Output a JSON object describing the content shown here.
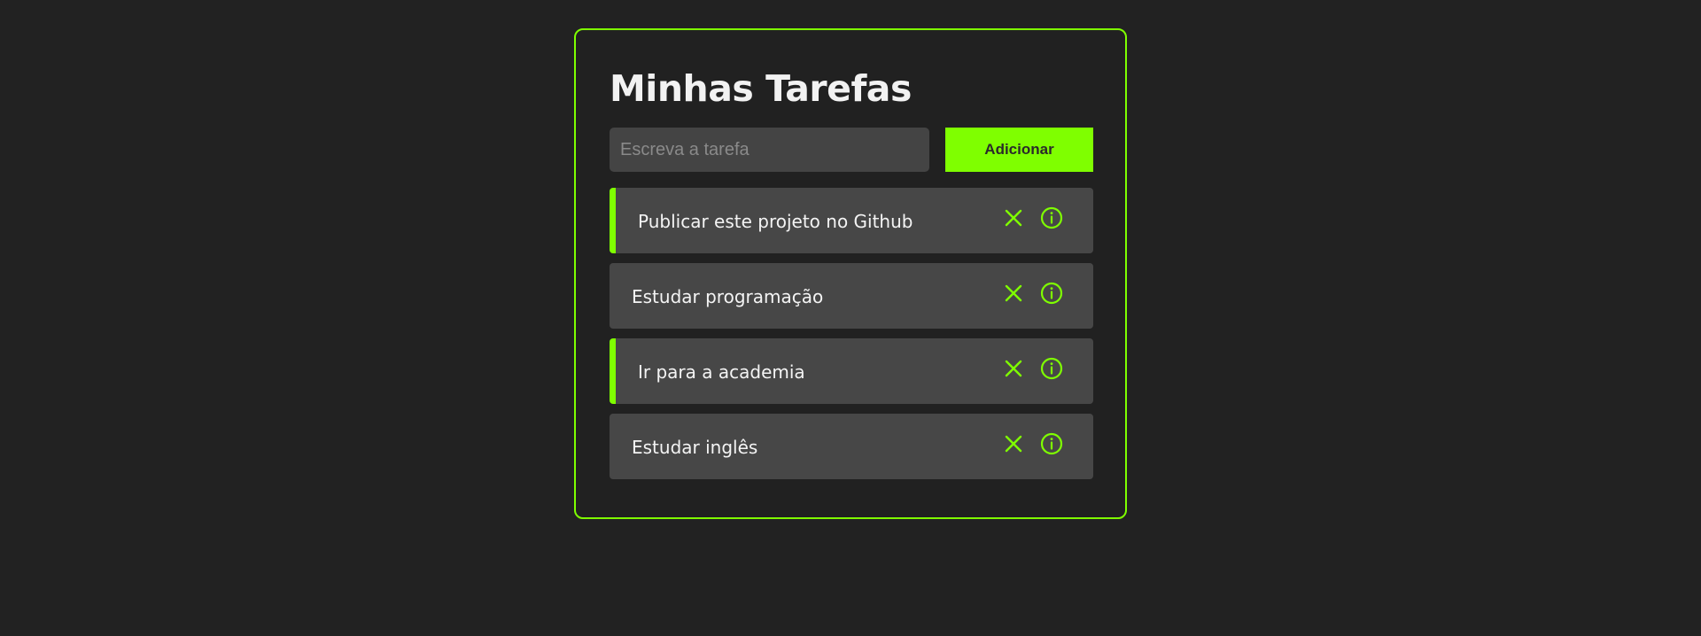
{
  "title": "Minhas Tarefas",
  "input": {
    "value": "",
    "placeholder": "Escreva a tarefa"
  },
  "add_button_label": "Adicionar",
  "accent_color": "#7fff00",
  "tasks": [
    {
      "label": "Publicar este projeto no Github",
      "completed": true
    },
    {
      "label": "Estudar programação",
      "completed": false
    },
    {
      "label": "Ir para a academia",
      "completed": true
    },
    {
      "label": "Estudar inglês",
      "completed": false
    }
  ],
  "task_icons": [
    "close-icon",
    "info-icon"
  ]
}
